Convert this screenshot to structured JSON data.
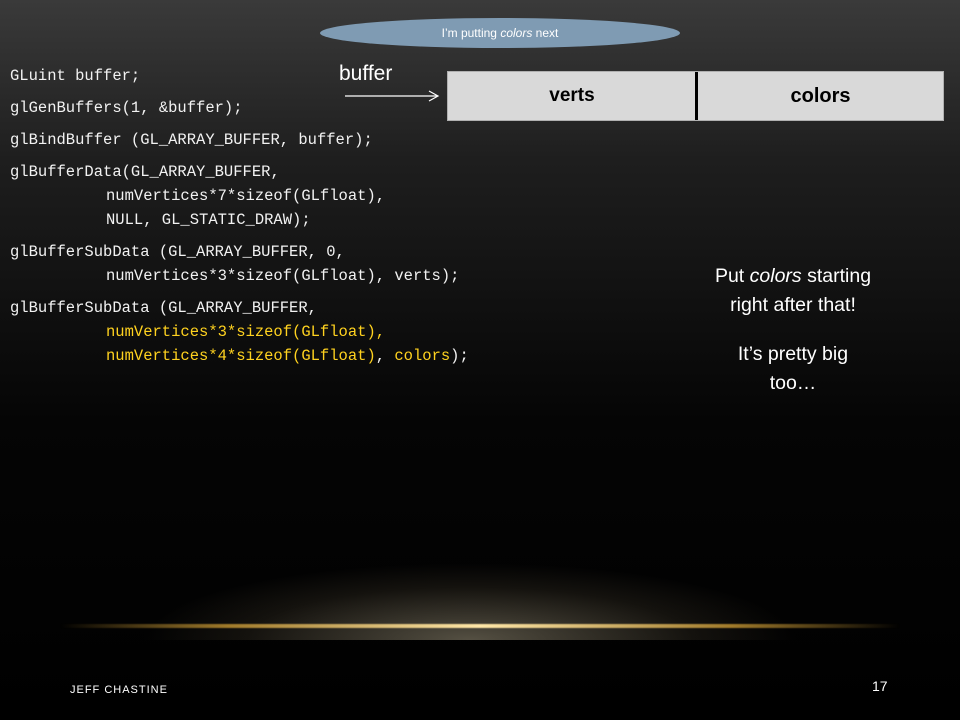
{
  "callout": {
    "prefix": "I’m putting ",
    "emph": "colors",
    "suffix": " next"
  },
  "code": {
    "line1": "GLuint buffer;",
    "line2": "glGenBuffers(1, &buffer);",
    "line3": "glBindBuffer (GL_ARRAY_BUFFER, buffer);",
    "line4a": "glBufferData(GL_ARRAY_BUFFER,",
    "line4b": "numVertices*7*sizeof(GLfloat),",
    "line4c": "NULL, GL_STATIC_DRAW);",
    "line5a": "glBufferSubData (GL_ARRAY_BUFFER, 0,",
    "line5b": "numVertices*3*sizeof(GLfloat), verts);",
    "line6a": "glBufferSubData (GL_ARRAY_BUFFER,",
    "line6b": "numVertices*3*sizeof(GLfloat)",
    "line6b_tail": ",",
    "line6c": "numVertices*4*sizeof(GLfloat)",
    "line6c_sep": ", ",
    "line6c_colors": "colors",
    "line6c_tail": ");"
  },
  "buffer": {
    "label": "buffer",
    "seg1": "verts",
    "seg2": "colors"
  },
  "note": {
    "line1_prefix": "Put ",
    "line1_emph": "colors",
    "line1_suffix": " starting",
    "line2": "right after that!",
    "line3": "It’s pretty big",
    "line4": "too…"
  },
  "footer": {
    "author": "JEFF CHASTINE",
    "page": "17"
  },
  "colors": {
    "highlight": "#ffd21f",
    "bubble": "#7f9bb3",
    "bar": "#d9d9d9"
  }
}
